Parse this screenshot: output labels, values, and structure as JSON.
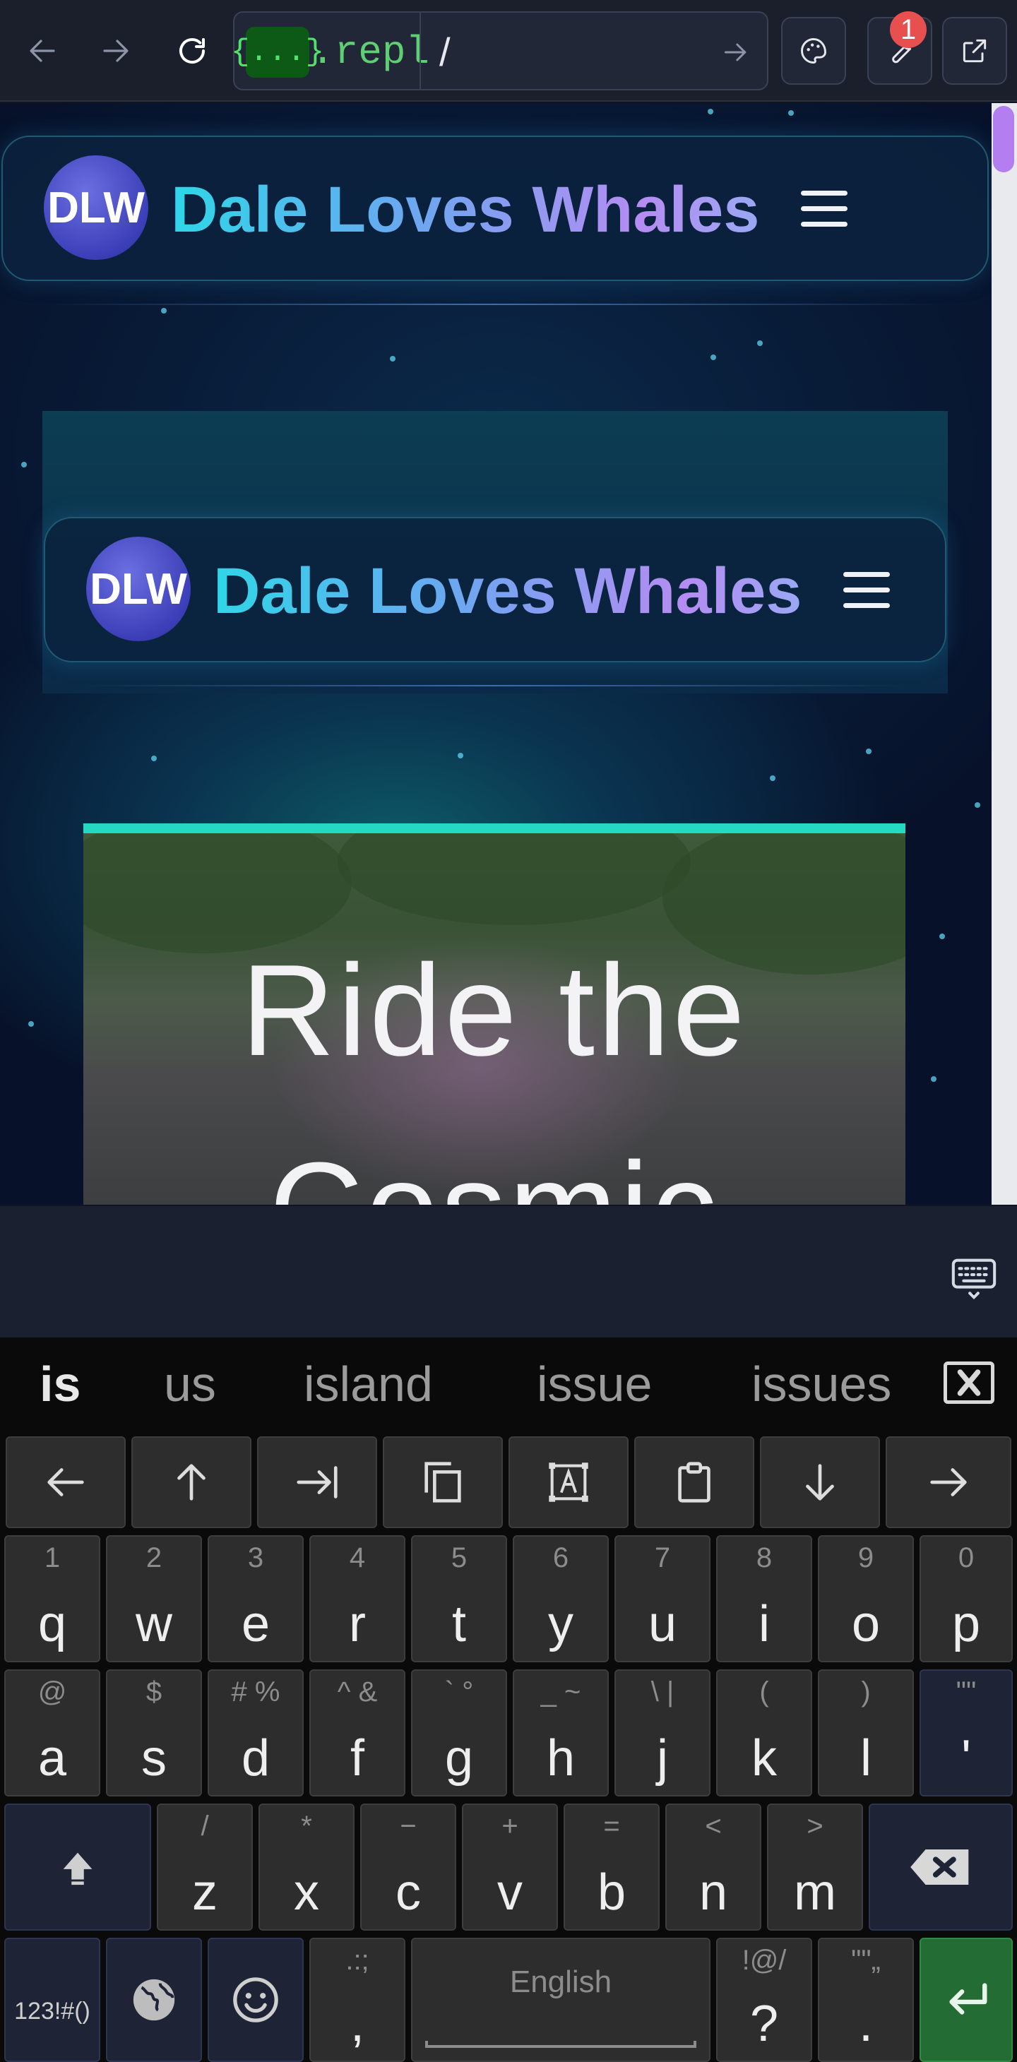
{
  "browser": {
    "url_badge": "{...}",
    "url_host": ".repl",
    "url_path": "/",
    "notification_count": "1"
  },
  "site": {
    "logo_initials": "DLW",
    "brand_name": "Dale Loves Whales"
  },
  "hero": {
    "title_line1": "Ride the",
    "title_line2": "Cosmic"
  },
  "suggestions": [
    "is",
    "us",
    "island",
    "issue",
    "issues"
  ],
  "keyboard": {
    "row_nav": [
      "left-arrow",
      "up-arrow",
      "tab-end",
      "copy",
      "select-text",
      "paste",
      "down-arrow",
      "right-arrow"
    ],
    "row1": [
      {
        "sub": "1",
        "main": "q"
      },
      {
        "sub": "2",
        "main": "w"
      },
      {
        "sub": "3",
        "main": "e"
      },
      {
        "sub": "4",
        "main": "r"
      },
      {
        "sub": "5",
        "main": "t"
      },
      {
        "sub": "6",
        "main": "y"
      },
      {
        "sub": "7",
        "main": "u"
      },
      {
        "sub": "8",
        "main": "i"
      },
      {
        "sub": "9",
        "main": "o"
      },
      {
        "sub": "0",
        "main": "p"
      }
    ],
    "row2": [
      {
        "sub": "@",
        "main": "a"
      },
      {
        "sub": "$",
        "main": "s"
      },
      {
        "sub": "# %",
        "main": "d"
      },
      {
        "sub": "^ &",
        "main": "f"
      },
      {
        "sub": "` °",
        "main": "g"
      },
      {
        "sub": "_ ~",
        "main": "h"
      },
      {
        "sub": "\\ |",
        "main": "j"
      },
      {
        "sub": "(",
        "main": "k"
      },
      {
        "sub": ")",
        "main": "l"
      },
      {
        "sub": "\"\"",
        "main": "'"
      }
    ],
    "row3": [
      {
        "sub": "/",
        "main": "z"
      },
      {
        "sub": "*",
        "main": "x"
      },
      {
        "sub": "−",
        "main": "c"
      },
      {
        "sub": "+",
        "main": "v"
      },
      {
        "sub": "=",
        "main": "b"
      },
      {
        "sub": "<",
        "main": "n"
      },
      {
        "sub": ">",
        "main": "m"
      }
    ],
    "symbols_label": "123!#()",
    "comma": {
      "sub": ".:;",
      "main": ","
    },
    "space_label": "English",
    "question": {
      "sub": "!@/",
      "main": "?"
    },
    "period": {
      "sub": "\"\"„",
      "main": "."
    }
  },
  "colors": {
    "accent_teal": "#24d8c2",
    "enter_green": "#236c34",
    "scroll_thumb": "#b37ff0",
    "notification": "#e8504f"
  }
}
